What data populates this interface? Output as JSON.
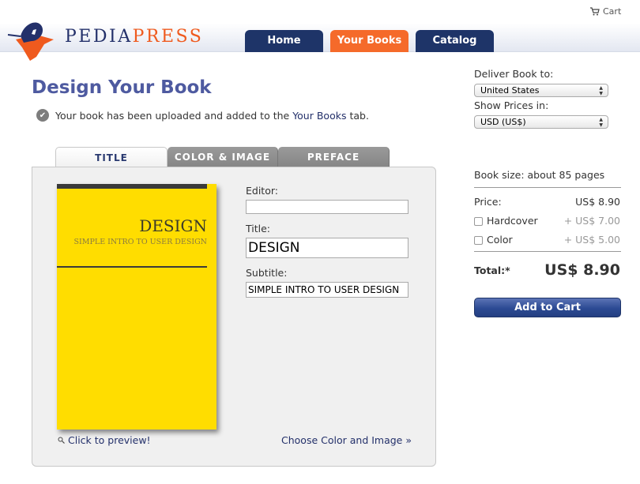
{
  "brand": {
    "name_part1": "PEDIA",
    "name_part2": "PRESS",
    "accent_blue": "#1e3468",
    "accent_orange": "#f56a2a"
  },
  "header": {
    "cart_label": "Cart",
    "nav": [
      {
        "label": "Home",
        "active": false
      },
      {
        "label": "Your Books",
        "active": true
      },
      {
        "label": "Catalog",
        "active": false
      }
    ]
  },
  "main": {
    "title": "Design Your Book",
    "notice": {
      "prefix": "Your book has been uploaded and added to the ",
      "link": "Your Books",
      "suffix": " tab."
    },
    "tabs": [
      {
        "label": "TITLE",
        "active": true
      },
      {
        "label": "COLOR & IMAGE",
        "active": false
      },
      {
        "label": "PREFACE",
        "active": false
      }
    ],
    "cover": {
      "title": "DESIGN",
      "subtitle": "SIMPLE INTRO TO USER DESIGN",
      "color": "#ffdd00"
    },
    "form": {
      "editor_label": "Editor:",
      "editor_value": "",
      "title_label": "Title:",
      "title_value": "DESIGN",
      "subtitle_label": "Subtitle:",
      "subtitle_value": "SIMPLE INTRO TO USER DESIGN"
    },
    "preview_link": "Click to preview!",
    "next_link": "Choose Color and Image »"
  },
  "sidebar": {
    "deliver_label": "Deliver Book to:",
    "deliver_value": "United States",
    "currency_label": "Show Prices in:",
    "currency_value": "USD (US$)",
    "book_size": "Book size: about 85 pages",
    "price_label": "Price:",
    "price_value": "US$ 8.90",
    "options": [
      {
        "label": "Hardcover",
        "price": "+ US$ 7.00",
        "checked": false
      },
      {
        "label": "Color",
        "price": "+ US$ 5.00",
        "checked": false
      }
    ],
    "total_label": "Total:*",
    "total_value": "US$ 8.90",
    "add_to_cart": "Add to Cart"
  }
}
